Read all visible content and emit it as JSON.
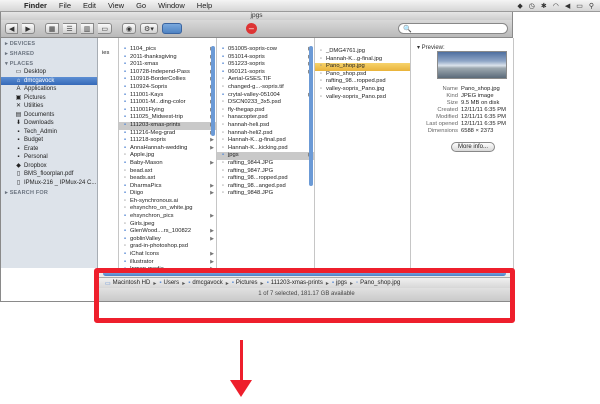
{
  "menubar": {
    "app": "Finder",
    "menus": [
      "File",
      "Edit",
      "View",
      "Go",
      "Window",
      "Help"
    ]
  },
  "window": {
    "title": "jpgs",
    "search_placeholder": "🔍"
  },
  "sidebar": {
    "sections": {
      "devices": "▸ DEVICES",
      "shared": "▸ SHARED",
      "places": "▾ PLACES",
      "search": "▸ SEARCH FOR"
    },
    "items": [
      {
        "label": "Desktop",
        "icon": "desktop-icon"
      },
      {
        "label": "dmcgavock",
        "icon": "home-icon"
      },
      {
        "label": "Applications",
        "icon": "applications-icon"
      },
      {
        "label": "Pictures",
        "icon": "pictures-icon"
      },
      {
        "label": "Utilities",
        "icon": "utilities-icon"
      },
      {
        "label": "Documents",
        "icon": "documents-icon"
      },
      {
        "label": "Downloads",
        "icon": "downloads-icon"
      },
      {
        "label": "Tech_Admin",
        "icon": "folder-icon"
      },
      {
        "label": "Budget",
        "icon": "folder-icon"
      },
      {
        "label": "Erate",
        "icon": "folder-icon"
      },
      {
        "label": "Personal",
        "icon": "folder-icon"
      },
      {
        "label": "Dropbox",
        "icon": "dropbox-icon"
      },
      {
        "label": "BMS_floorplan.pdf",
        "icon": "pdf-icon"
      },
      {
        "label": "IPMux-216 _ IPMux-24 C...",
        "icon": "pdf-icon"
      }
    ]
  },
  "columns": {
    "col0_fragment": "ies",
    "col1": [
      "1104_pics",
      "2011-thanksgiving",
      "2011-xmas",
      "110728-Independ-Pass",
      "110918-BorderCollies",
      "110924-Sopris",
      "111001-Kays",
      "111001-M...ding-color",
      "111001Flying",
      "111025_Midwest-trip",
      "111203-xmas-prints",
      "111216-Meg-grad",
      "111218-sopris",
      "AnnaHannah-wedding",
      "Apple.jpg",
      "Baby-Mason",
      "bead.axt",
      "beads.axt",
      "DharmaPics",
      "Diigo",
      "Eh-synchronous.ai",
      "ehsynchro_on_white.jpg",
      "ehsynchron_pics",
      "Girls.jpeg",
      "GlenWood....rs_100822",
      "goblinValley",
      "grad-in-photoshop.psd",
      "iChat Icons",
      "illustrator",
      "Inman-media",
      "iPhoto Library",
      "iPod Photo Cache"
    ],
    "col2": [
      "051005-sopris-cow",
      "051014-sopris",
      "051223-sopris",
      "060121-sopris",
      "Aerial-GSES.TIF",
      "changed-g...-sopris.tif",
      "crytal-valley-051004",
      "DSCN0233_3x5.psd",
      "fly-thegap.psd",
      "hanacopter.psd",
      "hannah-heli.psd",
      "hannah-heli2.psd",
      "Hannah-K...g-final.psd",
      "Hannah-K...kicking.psd",
      "jpgs",
      "rafting_9844.JPG",
      "rafting_9847.JPG",
      "rafting_98...ropped.psd",
      "rafting_98...anged.psd",
      "rafting_9848.JPG"
    ],
    "col3": [
      "_DMG4761.jpg",
      "Hannah-K...g-final.jpg",
      "Pano_shop.jpg",
      "Pano_shop.psd",
      "rafting_98...ropped.psd",
      "valley-sopris_Pano.jpg",
      "valley-sopris_Pano.psd"
    ]
  },
  "preview": {
    "label": "▾ Preview:",
    "meta": [
      {
        "k": "Name",
        "v": "Pano_shop.jpg"
      },
      {
        "k": "Kind",
        "v": "JPEG image"
      },
      {
        "k": "Size",
        "v": "9.5 MB on disk"
      },
      {
        "k": "Created",
        "v": "12/11/11 6:35 PM"
      },
      {
        "k": "Modified",
        "v": "12/11/11 6:35 PM"
      },
      {
        "k": "Last opened",
        "v": "12/11/11 6:35 PM"
      },
      {
        "k": "Dimensions",
        "v": "6588 × 2373"
      }
    ],
    "more_info": "More info..."
  },
  "pathbar": [
    "Macintosh HD",
    "Users",
    "dmcgavock",
    "Pictures",
    "111203-xmas-prints",
    "jpgs",
    "Pano_shop.jpg"
  ],
  "status": "1 of 7 selected, 181.17 GB available",
  "colors": {
    "highlight": "#ee1f2c",
    "selection": "#3569b8"
  }
}
